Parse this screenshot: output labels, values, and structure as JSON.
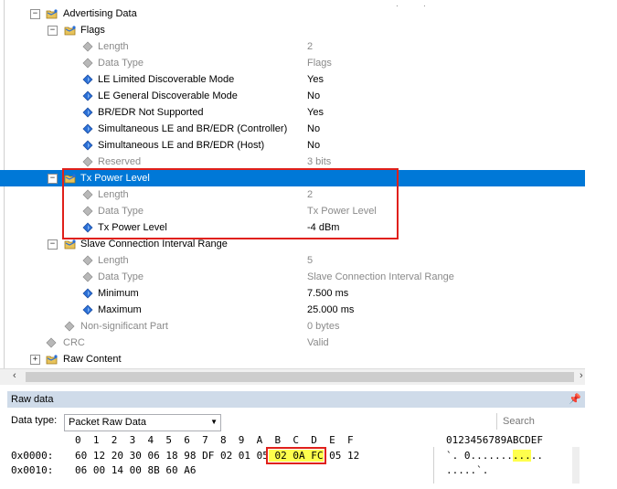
{
  "tree": {
    "rows": [
      {
        "label": "Advertising Data",
        "value": "",
        "expander": "⊟",
        "gray": false
      },
      {
        "label": "Flags",
        "value": "",
        "expander": "⊟",
        "gray": false
      },
      {
        "label": "Length",
        "value": "2",
        "gray": true
      },
      {
        "label": "Data Type",
        "value": "Flags",
        "gray": true
      },
      {
        "label": "LE Limited Discoverable Mode",
        "value": "Yes",
        "gray": false
      },
      {
        "label": "LE General Discoverable Mode",
        "value": "No",
        "gray": false
      },
      {
        "label": "BR/EDR Not Supported",
        "value": "Yes",
        "gray": false
      },
      {
        "label": "Simultaneous LE and BR/EDR (Controller)",
        "value": "No",
        "gray": false
      },
      {
        "label": "Simultaneous LE and BR/EDR (Host)",
        "value": "No",
        "gray": false
      },
      {
        "label": "Reserved",
        "value": "3 bits",
        "gray": true
      },
      {
        "label": "Tx Power Level",
        "value": "",
        "expander": "⊟",
        "gray": false
      },
      {
        "label": "Length",
        "value": "2",
        "gray": true
      },
      {
        "label": "Data Type",
        "value": "Tx Power Level",
        "gray": true
      },
      {
        "label": "Tx Power Level",
        "value": "-4 dBm",
        "gray": false
      },
      {
        "label": "Slave Connection Interval Range",
        "value": "",
        "expander": "⊟",
        "gray": false
      },
      {
        "label": "Length",
        "value": "5",
        "gray": true
      },
      {
        "label": "Data Type",
        "value": "Slave Connection Interval Range",
        "gray": true
      },
      {
        "label": "Minimum",
        "value": "7.500 ms",
        "gray": false
      },
      {
        "label": "Maximum",
        "value": "25.000 ms",
        "gray": false
      },
      {
        "label": "Non-significant Part",
        "value": "0 bytes",
        "gray": true
      },
      {
        "label": "CRC",
        "value": "Valid",
        "gray": true
      },
      {
        "label": "Raw Content",
        "value": "",
        "expander": "⊞",
        "gray": false
      }
    ]
  },
  "rawdata": {
    "title": "Raw data",
    "data_type_label": "Data type:",
    "data_type_value": "Packet Raw Data",
    "search_placeholder": "Search",
    "header_cols": "0  1  2  3  4  5  6  7  8  9  A  B  C  D  E  F",
    "ascii_header": "0123456789ABCDEF",
    "rows": [
      {
        "addr": "0x0000:",
        "pre": "60 12 20 30 06 18 98 DF 02 01 05",
        "hl": "02 0A FC",
        "post": "05 12",
        "ascii_pre": "`. 0.......",
        "ascii_hl": "...",
        "ascii_post": ".."
      },
      {
        "addr": "0x0010:",
        "pre": "06 00 14 00 8B 60 A6",
        "hl": "",
        "post": "",
        "ascii_pre": ".....`.",
        "ascii_hl": "",
        "ascii_post": ""
      }
    ]
  },
  "colors": {
    "selection": "#0078d7",
    "highlight": "#ffff4d",
    "annotation_box": "#e0201a"
  }
}
